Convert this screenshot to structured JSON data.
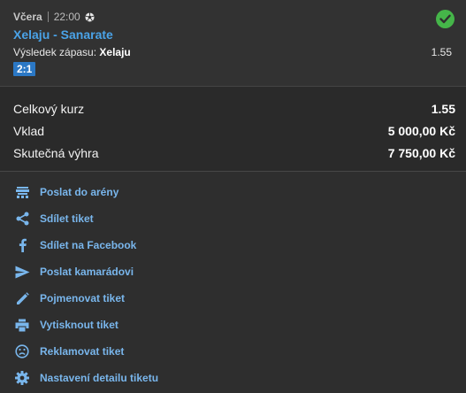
{
  "match": {
    "day": "Včera",
    "time": "22:00",
    "teams": "Xelaju - Sanarate",
    "result_label": "Výsledek zápasu:",
    "result_pick": "Xelaju",
    "odd": "1.55",
    "score": "2:1"
  },
  "summary": {
    "total_odds_label": "Celkový kurz",
    "total_odds_value": "1.55",
    "stake_label": "Vklad",
    "stake_value": "5 000,00 Kč",
    "win_label": "Skutečná výhra",
    "win_value": "7 750,00 Kč"
  },
  "actions": [
    {
      "label": "Poslat do arény",
      "icon": "arena-icon"
    },
    {
      "label": "Sdílet tiket",
      "icon": "share-icon"
    },
    {
      "label": "Sdílet na Facebook",
      "icon": "facebook-icon"
    },
    {
      "label": "Poslat kamarádovi",
      "icon": "send-icon"
    },
    {
      "label": "Pojmenovat tiket",
      "icon": "pencil-icon"
    },
    {
      "label": "Vytisknout tiket",
      "icon": "print-icon"
    },
    {
      "label": "Reklamovat tiket",
      "icon": "sad-face-icon"
    },
    {
      "label": "Nastavení detailu tiketu",
      "icon": "gear-icon"
    }
  ],
  "colors": {
    "accent": "#4aa3e8",
    "link": "#79b6ec",
    "success": "#45b549",
    "score_bg": "#2b78c5"
  }
}
